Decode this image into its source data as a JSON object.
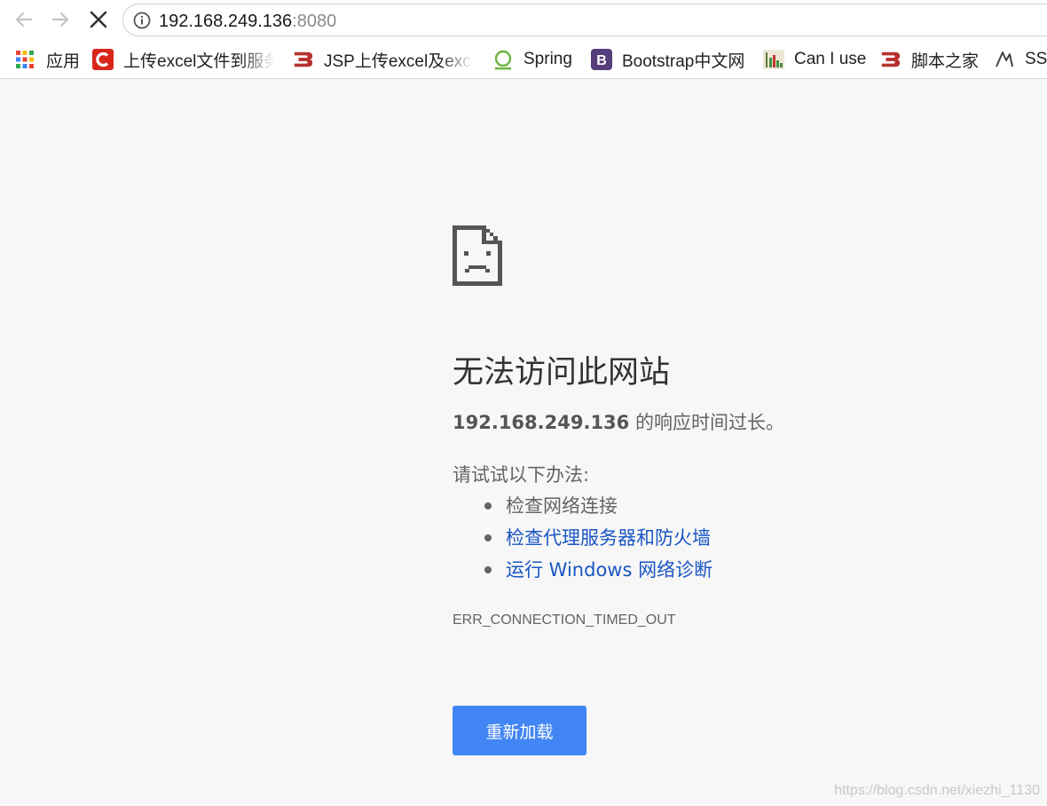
{
  "address_bar": {
    "host": "192.168.249.136",
    "port": ":8080"
  },
  "bookmarks": {
    "apps_label": "应用",
    "items": [
      {
        "label": "上传excel文件到服务",
        "icon": "csdn-logo-icon"
      },
      {
        "label": "JSP上传excel及excel",
        "icon": "jb51-logo-icon"
      },
      {
        "label": "Spring",
        "icon": "spring-logo-icon"
      },
      {
        "label": "Bootstrap中文网",
        "icon": "bootstrap-logo-icon"
      },
      {
        "label": "Can I use",
        "icon": "caniuse-logo-icon"
      },
      {
        "label": "脚本之家",
        "icon": "jb51-logo-icon"
      },
      {
        "label": "SSM",
        "icon": "ssm-logo-icon"
      }
    ]
  },
  "error_page": {
    "icon": "sad-page-icon",
    "title": "无法访问此网站",
    "summary_host": "192.168.249.136",
    "summary_rest": " 的响应时间过长。",
    "try_label": "请试试以下办法:",
    "suggestions": [
      {
        "text": "检查网络连接",
        "link": false
      },
      {
        "text": "检查代理服务器和防火墙",
        "link": true
      },
      {
        "text": "运行 Windows 网络诊断",
        "link": true
      }
    ],
    "error_code": "ERR_CONNECTION_TIMED_OUT",
    "reload_label": "重新加载"
  },
  "watermark": "https://blog.csdn.net/xiezhi_1130",
  "colors": {
    "accent": "#4285f4",
    "link": "#1a56c4",
    "page_bg": "#f7f7f7"
  }
}
